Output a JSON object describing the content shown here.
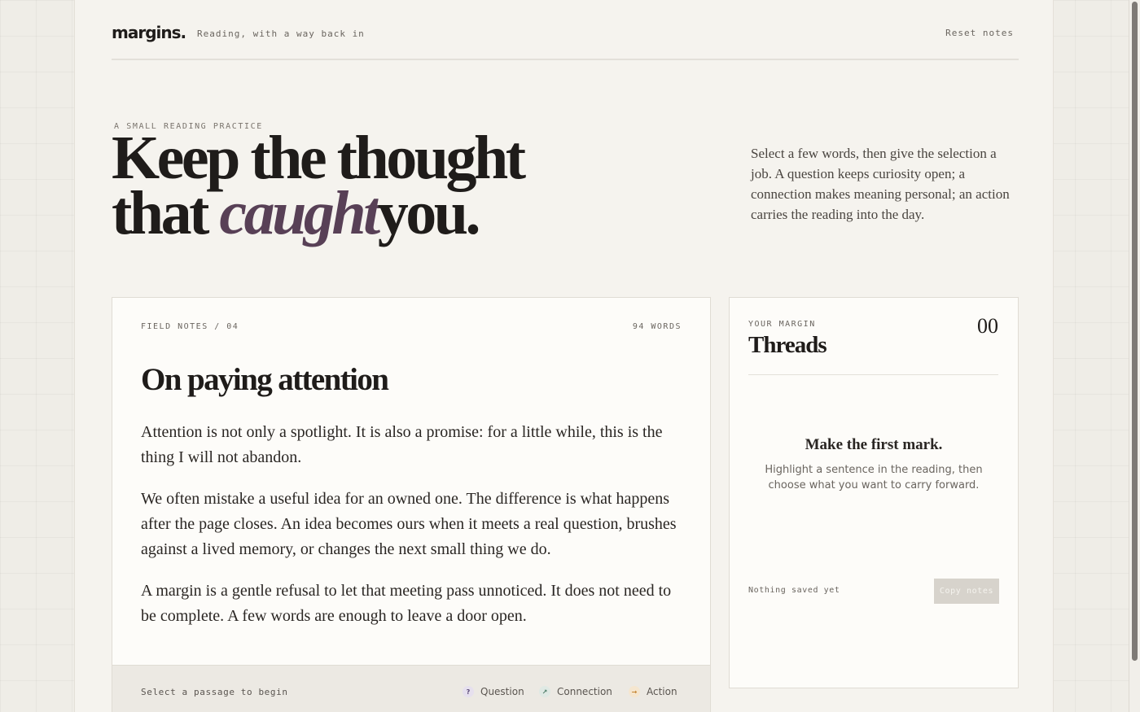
{
  "header": {
    "logo": "margins.",
    "tagline": "Reading, with a way back in",
    "reset_label": "Reset notes"
  },
  "hero": {
    "eyebrow": "A SMALL READING PRACTICE",
    "title_line1": "Keep the thought",
    "title_pre": "that ",
    "title_accent": "caught",
    "title_post": "you.",
    "intro": "Select a few words, then give the selection a job. A question keeps curiosity open; a connection makes meaning personal; an action carries the reading into the day."
  },
  "reading": {
    "label": "FIELD NOTES / 04",
    "word_count": "94 WORDS",
    "title": "On paying attention",
    "paragraphs": [
      "Attention is not only a spotlight. It is also a promise: for a little while, this is the thing I will not abandon.",
      "We often mistake a useful idea for an owned one. The difference is what happens after the page closes. An idea becomes ours when it meets a real question, brushes against a lived memory, or changes the next small thing we do.",
      "A margin is a gentle refusal to let that meeting pass unnoticed. It does not need to be complete. A few words are enough to leave a door open."
    ],
    "action_bar": {
      "hint": "Select a passage to begin",
      "question_icon": "?",
      "question_label": "Question",
      "connection_icon": "↗",
      "connection_label": "Connection",
      "action_icon": "→",
      "action_label": "Action"
    }
  },
  "threads": {
    "eyebrow": "YOUR MARGIN",
    "title": "Threads",
    "count": "00",
    "empty_title": "Make the first mark.",
    "empty_text": "Highlight a sentence in the reading, then choose what you want to carry forward.",
    "status": "Nothing saved yet",
    "copy_label": "Copy notes"
  },
  "colors": {
    "accent": "#584056",
    "question": "#5b4a78",
    "connection": "#4a7a64",
    "action": "#c4822e"
  }
}
